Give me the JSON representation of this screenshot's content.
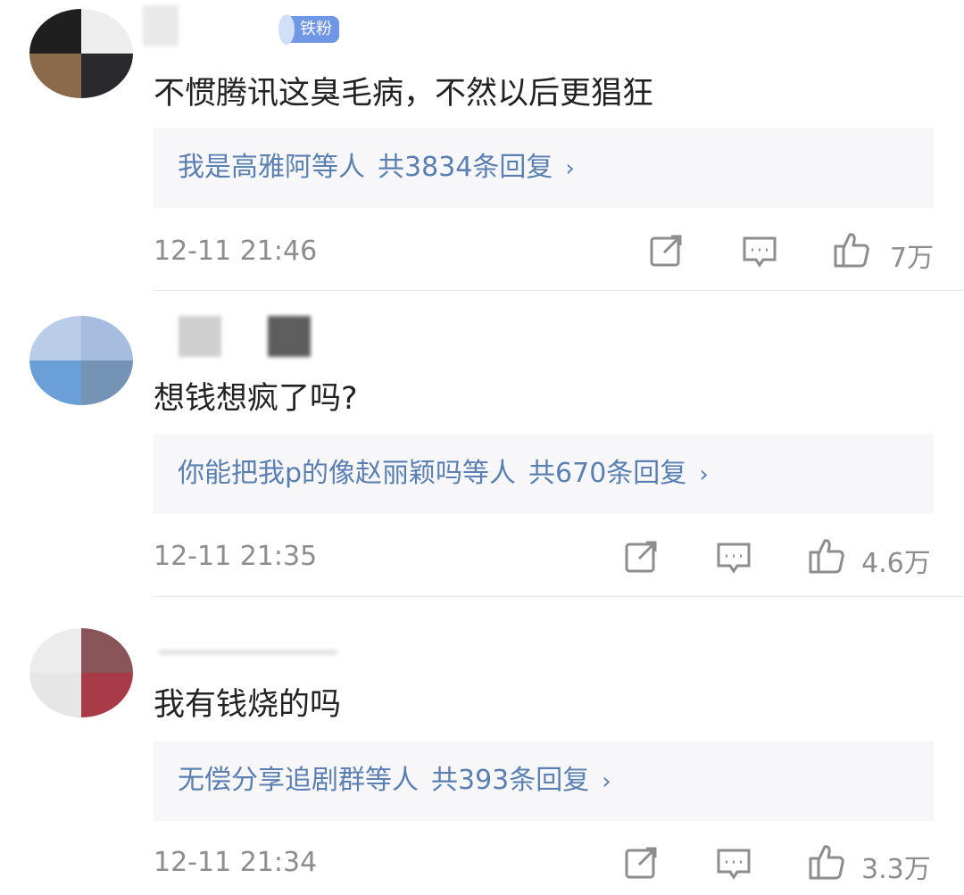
{
  "comments": [
    {
      "badge": "铁粉",
      "text": "不惯腾讯这臭毛病，不然以后更猖狂",
      "replies": {
        "names": "我是高雅阿等人",
        "count": "共3834条回复",
        "chevron": "›"
      },
      "time": "12-11 21:46",
      "likes": "7万"
    },
    {
      "text": "想钱想疯了吗?",
      "replies": {
        "names": "你能把我p的像赵丽颖吗等人",
        "count": "共670条回复",
        "chevron": "›"
      },
      "time": "12-11 21:35",
      "likes": "4.6万"
    },
    {
      "text": "我有钱烧的吗",
      "replies": {
        "names": "无偿分享追剧群等人",
        "count": "共393条回复",
        "chevron": "›"
      },
      "time": "12-11 21:34",
      "likes": "3.3万"
    }
  ],
  "icons": {
    "share": "share-icon",
    "comment": "comment-icon",
    "like": "thumbs-up-icon"
  },
  "colors": {
    "reply_link": "#5a7fb0",
    "badge": "#6f97e6",
    "meta_text": "#8d8d8d"
  }
}
